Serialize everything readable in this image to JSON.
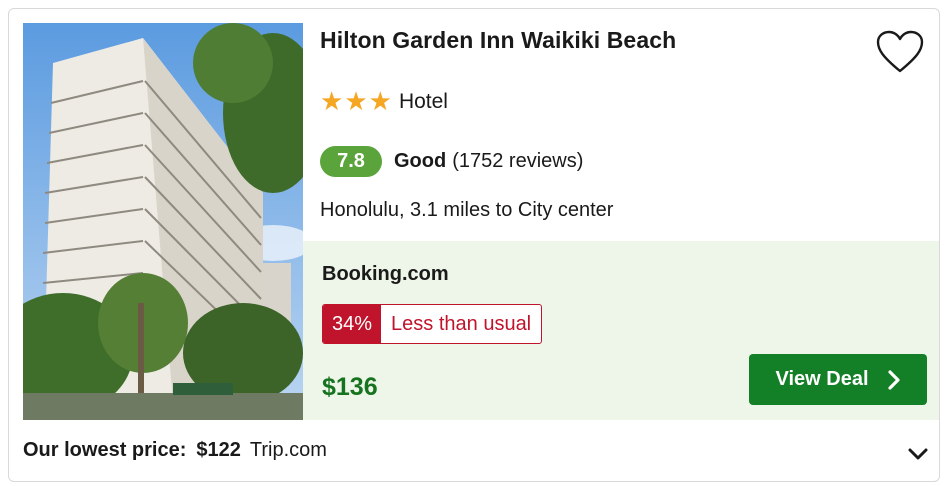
{
  "hotel": {
    "name": "Hilton Garden Inn Waikiki Beach",
    "stars": 3,
    "type": "Hotel",
    "rating": "7.8",
    "rating_label": "Good",
    "reviews": "(1752 reviews)",
    "location": "Honolulu, 3.1 miles to City center"
  },
  "deal": {
    "provider": "Booking.com",
    "discount_pct": "34%",
    "discount_text": "Less than usual",
    "price": "$136",
    "button_label": "View Deal"
  },
  "footer": {
    "label": "Our lowest price:",
    "price": "$122",
    "source": "Trip.com"
  },
  "icons": {
    "favorite": "heart-outline-icon",
    "star": "star-icon",
    "button_chevron": "chevron-right-icon",
    "expand": "chevron-down-icon"
  },
  "colors": {
    "rating_badge": "#5ba33b",
    "star": "#f5a623",
    "deal_panel": "#eef5e9",
    "discount": "#c0142c",
    "price": "#16731f",
    "button": "#137f27"
  }
}
